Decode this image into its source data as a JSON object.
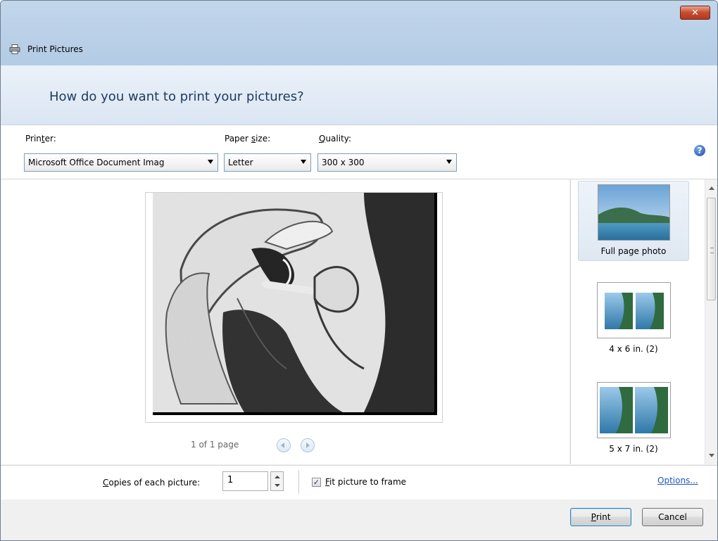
{
  "window": {
    "title": "Print Pictures",
    "close_label": "✕"
  },
  "header": {
    "question": "How do you want to print your pictures?"
  },
  "controls": {
    "printer": {
      "label_pre": "Prin",
      "label_key": "t",
      "label_post": "er:",
      "value": "Microsoft Office Document Imag"
    },
    "paper_size": {
      "label_pre": "Paper ",
      "label_key": "s",
      "label_post": "ize:",
      "value": "Letter"
    },
    "quality": {
      "label_key": "Q",
      "label_post": "uality:",
      "value": "300 x 300"
    },
    "help_glyph": "?"
  },
  "preview": {
    "page_info": "1 of 1 page"
  },
  "layouts": {
    "items": [
      {
        "label": "Full page photo",
        "selected": true
      },
      {
        "label": "4 x 6 in. (2)",
        "selected": false
      },
      {
        "label": "5 x 7 in. (2)",
        "selected": false
      }
    ]
  },
  "options_bar": {
    "copies_label_key": "C",
    "copies_label_post": "opies of each picture:",
    "copies_value": "1",
    "fit_label_key": "F",
    "fit_label_post": "it picture to frame",
    "fit_checked_glyph": "✓",
    "options_link": "Options..."
  },
  "footer": {
    "print_key": "P",
    "print_post": "rint",
    "cancel_label": "Cancel"
  },
  "colors": {
    "titlebar": "#bcd2e9",
    "header_text": "#1e395b",
    "close_button": "#c74a2e",
    "link": "#1e56b8"
  }
}
